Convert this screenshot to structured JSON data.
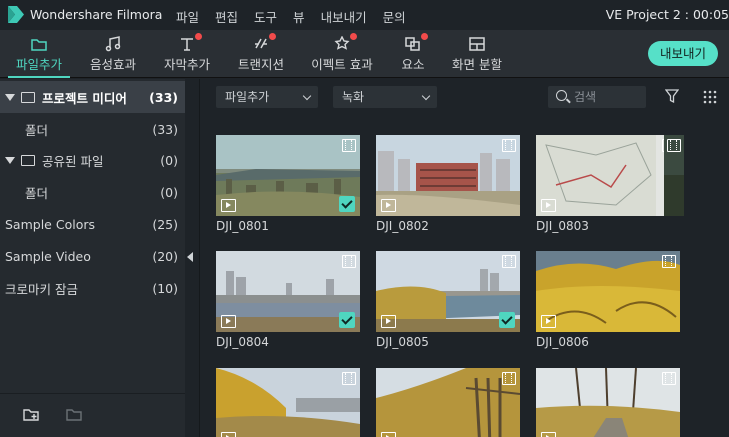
{
  "app": {
    "name": "Wondershare Filmora",
    "project": "VE Project 2 : 00:05"
  },
  "menu": [
    "파일",
    "편집",
    "도구",
    "뷰",
    "내보내기",
    "문의"
  ],
  "toolbar": {
    "tabs": [
      {
        "label": "파일추가",
        "icon": "folder-icon",
        "active": true,
        "dot": false
      },
      {
        "label": "음성효과",
        "icon": "music-note-icon",
        "active": false,
        "dot": false
      },
      {
        "label": "자막추가",
        "icon": "text-icon",
        "active": false,
        "dot": true
      },
      {
        "label": "트랜지션",
        "icon": "transition-icon",
        "active": false,
        "dot": true
      },
      {
        "label": "이펙트 효과",
        "icon": "effects-icon",
        "active": false,
        "dot": true
      },
      {
        "label": "요소",
        "icon": "elements-icon",
        "active": false,
        "dot": true
      },
      {
        "label": "화면 분할",
        "icon": "split-screen-icon",
        "active": false,
        "dot": false
      }
    ],
    "export_label": "내보내기"
  },
  "sidebar": {
    "items": [
      {
        "label": "프로젝트 미디어",
        "count": "(33)"
      },
      {
        "label": "폴더",
        "count": "(33)"
      },
      {
        "label": "공유된 파일",
        "count": "(0)"
      },
      {
        "label": "폴더",
        "count": "(0)"
      },
      {
        "label": "Sample Colors",
        "count": "(25)"
      },
      {
        "label": "Sample Video",
        "count": "(20)"
      },
      {
        "label": "크로마키 잠금",
        "count": "(10)"
      }
    ]
  },
  "filters": {
    "source": "파일추가",
    "record": "녹화",
    "search_placeholder": "검색"
  },
  "media": [
    {
      "name": "DJI_0801",
      "checked": true,
      "scene": "river"
    },
    {
      "name": "DJI_0802",
      "checked": false,
      "scene": "building"
    },
    {
      "name": "DJI_0803",
      "checked": false,
      "scene": "map"
    },
    {
      "name": "DJI_0804",
      "checked": true,
      "scene": "city"
    },
    {
      "name": "DJI_0805",
      "checked": true,
      "scene": "bridge"
    },
    {
      "name": "DJI_0806",
      "checked": false,
      "scene": "forsythia"
    },
    {
      "name": "",
      "checked": false,
      "scene": "forsythia2"
    },
    {
      "name": "",
      "checked": false,
      "scene": "stairs"
    },
    {
      "name": "",
      "checked": false,
      "scene": "path"
    }
  ],
  "colors": {
    "accent": "#4fd6c0",
    "badge": "#f24b4b",
    "export": "#56e0c8"
  }
}
